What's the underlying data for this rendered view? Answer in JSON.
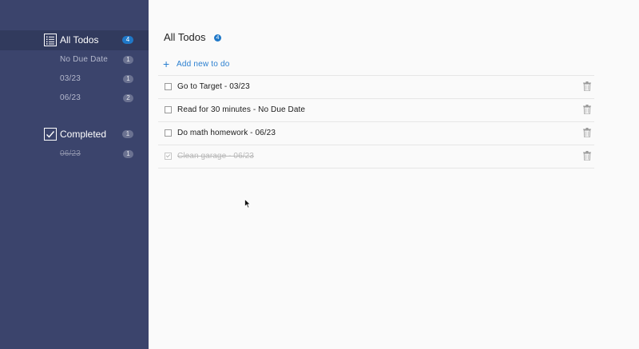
{
  "sidebar": {
    "all_todos": {
      "label": "All Todos",
      "count": "4",
      "items": [
        {
          "label": "No Due Date",
          "count": "1"
        },
        {
          "label": "03/23",
          "count": "1"
        },
        {
          "label": "06/23",
          "count": "2"
        }
      ]
    },
    "completed": {
      "label": "Completed",
      "count": "1",
      "items": [
        {
          "label": "06/23",
          "count": "1"
        }
      ]
    }
  },
  "main": {
    "title": "All Todos",
    "count": "4",
    "add_label": "Add new to do",
    "todos": [
      {
        "text": "Go to Target - 03/23",
        "completed": false
      },
      {
        "text": "Read for 30 minutes - No Due Date",
        "completed": false
      },
      {
        "text": "Do math homework - 06/23",
        "completed": false
      },
      {
        "text": "Clean garage - 06/23",
        "completed": true
      }
    ]
  },
  "colors": {
    "sidebar_bg": "#3b446c",
    "sidebar_active_bg": "#313a5d",
    "accent": "#1f78c8"
  },
  "icons": {
    "all_todos": "list-icon",
    "completed": "checked-box-icon",
    "add": "plus-icon",
    "delete": "trash-icon"
  }
}
